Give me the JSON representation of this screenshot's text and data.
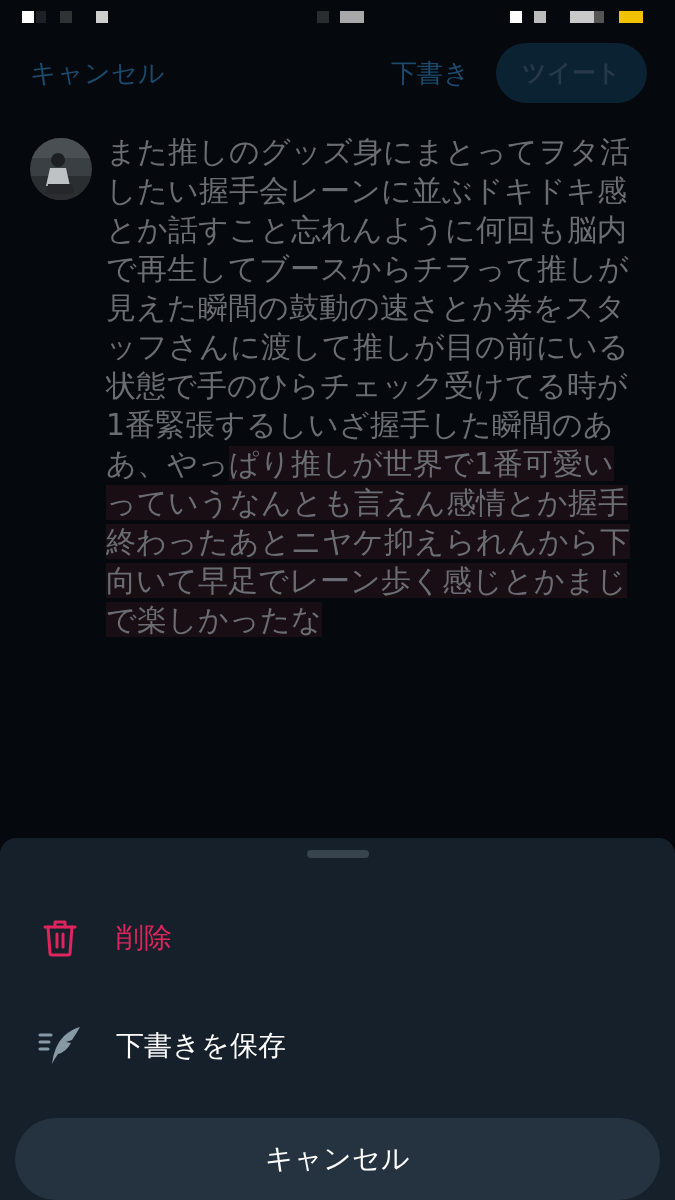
{
  "header": {
    "cancel": "キャンセル",
    "drafts": "下書き",
    "tweet": "ツイート"
  },
  "compose": {
    "text": "また推しのグッズ身にまとってヲタ活したい握手会レーンに並ぶドキドキ感とか話すこと忘れんように何回も脳内で再生してブースからチラって推しが見えた瞬間の鼓動の速さとか券をスタッフさんに渡して推しが目の前にいる状態で手のひらチェック受けてる時が1番緊張するしいざ握手した瞬間のああ、やっ",
    "overflow_text": "ぱり推しが世界で1番可愛いっていうなんとも言えん感情とか握手終わったあとニヤケ抑えられんから下向いて早足でレーン歩く感じとかまじで楽しかったな"
  },
  "sheet": {
    "actions": [
      {
        "kind": "delete",
        "label": "削除"
      },
      {
        "kind": "save_draft",
        "label": "下書きを保存"
      }
    ],
    "cancel": "キャンセル"
  }
}
